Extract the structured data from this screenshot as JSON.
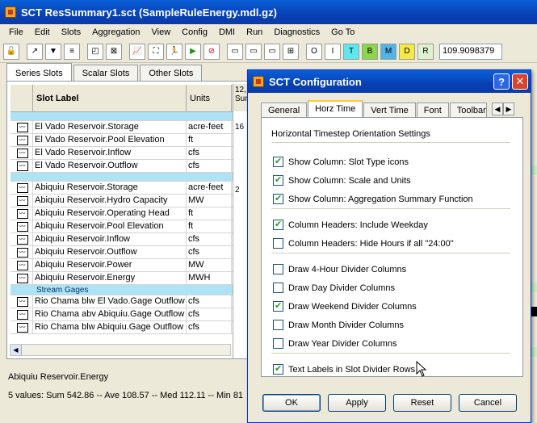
{
  "main": {
    "title": "SCT ResSummary1.sct (SampleRuleEnergy.mdl.gz)",
    "menu": [
      "File",
      "Edit",
      "Slots",
      "Aggregation",
      "View",
      "Config",
      "DMI",
      "Run",
      "Diagnostics",
      "Go To"
    ],
    "toolbar_letters": [
      "O",
      "I",
      "T",
      "B",
      "M",
      "D",
      "R"
    ],
    "toolbar_value": "109.9098379",
    "tabs": [
      "Series Slots",
      "Scalar Slots",
      "Other Slots"
    ],
    "grid": {
      "col_label": "Slot Label",
      "col_units": "Units",
      "col_date": "12,",
      "col_date2": "Sun",
      "rows": [
        {
          "type": "divider",
          "label": ""
        },
        {
          "type": "slot",
          "label": "El Vado Reservoir.Storage",
          "units": "acre-feet",
          "val": "16"
        },
        {
          "type": "slot",
          "label": "El Vado Reservoir.Pool Elevation",
          "units": "ft",
          "val": ""
        },
        {
          "type": "slot",
          "label": "El Vado Reservoir.Inflow",
          "units": "cfs",
          "val": ""
        },
        {
          "type": "slot",
          "label": "El Vado Reservoir.Outflow",
          "units": "cfs",
          "val": ""
        },
        {
          "type": "divider",
          "label": ""
        },
        {
          "type": "slot",
          "label": "Abiquiu Reservoir.Storage",
          "units": "acre-feet",
          "val": "2"
        },
        {
          "type": "slot",
          "label": "Abiquiu Reservoir.Hydro Capacity",
          "units": "MW",
          "val": ""
        },
        {
          "type": "slot",
          "label": "Abiquiu Reservoir.Operating Head",
          "units": "ft",
          "val": ""
        },
        {
          "type": "slot",
          "label": "Abiquiu Reservoir.Pool Elevation",
          "units": "ft",
          "val": ""
        },
        {
          "type": "slot",
          "label": "Abiquiu Reservoir.Inflow",
          "units": "cfs",
          "val": ""
        },
        {
          "type": "slot",
          "label": "Abiquiu Reservoir.Outflow",
          "units": "cfs",
          "val": ""
        },
        {
          "type": "slot",
          "label": "Abiquiu Reservoir.Power",
          "units": "MW",
          "val": ""
        },
        {
          "type": "slot",
          "label": "Abiquiu Reservoir.Energy",
          "units": "MWH",
          "val": ""
        },
        {
          "type": "divider",
          "label": "Stream Gages"
        },
        {
          "type": "slot",
          "label": "Rio Chama blw El Vado.Gage Outflow",
          "units": "cfs",
          "val": ""
        },
        {
          "type": "slot",
          "label": "Rio Chama abv Abiquiu.Gage Outflow",
          "units": "cfs",
          "val": ""
        },
        {
          "type": "slot",
          "label": "Rio Chama blw Abiquiu.Gage Outflow",
          "units": "cfs",
          "val": ""
        }
      ]
    },
    "status_name": "Abiquiu Reservoir.Energy",
    "status_stats": "5 values:  Sum 542.86 -- Ave 108.57 -- Med 112.11 -- Min 81"
  },
  "dialog": {
    "title": "SCT Configuration",
    "tabs": [
      "General",
      "Horz Time",
      "Vert Time",
      "Font",
      "Toolbar"
    ],
    "heading": "Horizontal Timestep Orientation Settings",
    "options": [
      {
        "label": "Show Column: Slot Type icons",
        "checked": true
      },
      {
        "label": "Show Column: Scale and Units",
        "checked": true
      },
      {
        "label": "Show Column: Aggregation Summary Function",
        "checked": true
      },
      {
        "label": "Column Headers: Include Weekday",
        "checked": true
      },
      {
        "label": "Column Headers: Hide Hours if all \"24:00\"",
        "checked": false
      },
      {
        "label": "Draw 4-Hour Divider Columns",
        "checked": false
      },
      {
        "label": "Draw Day Divider Columns",
        "checked": false
      },
      {
        "label": "Draw Weekend Divider Columns",
        "checked": true
      },
      {
        "label": "Draw Month Divider Columns",
        "checked": false
      },
      {
        "label": "Draw Year Divider Columns",
        "checked": false
      },
      {
        "label": "Text Labels in Slot Divider Rows",
        "checked": true
      }
    ],
    "buttons": {
      "ok": "OK",
      "apply": "Apply",
      "reset": "Reset",
      "cancel": "Cancel"
    }
  },
  "colors": {
    "title_blue": "#0a5fd8",
    "divider_row": "#aee3f5",
    "close_red": "#d9442b"
  }
}
